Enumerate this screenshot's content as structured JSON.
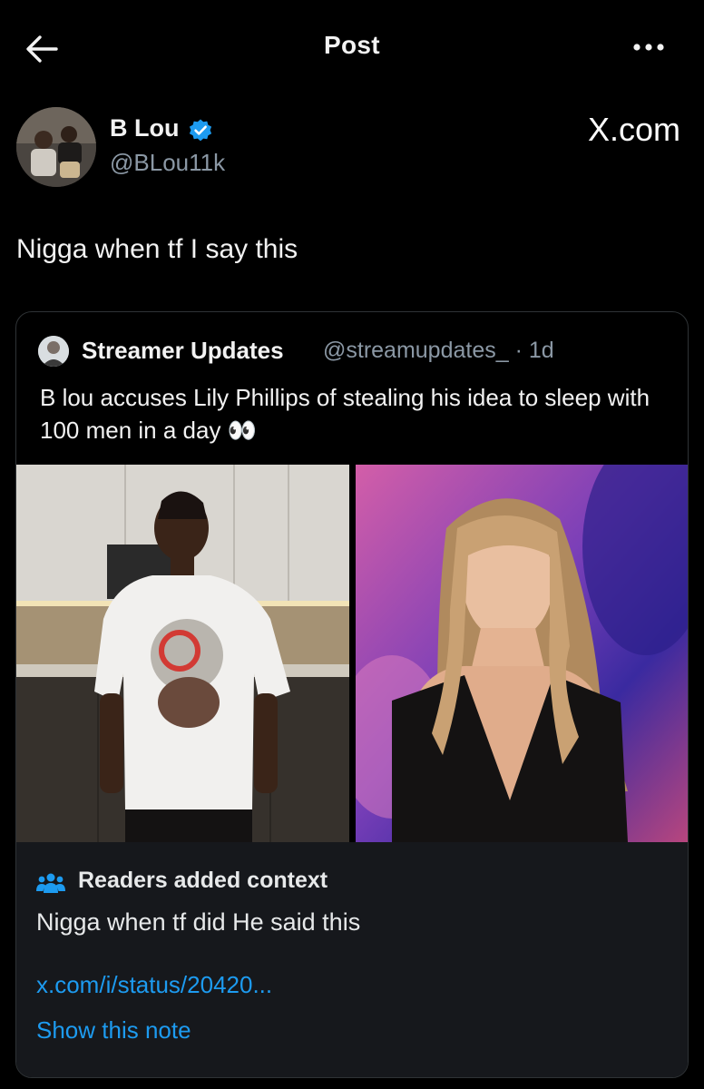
{
  "header": {
    "title": "Post",
    "back_icon": "arrow-left-icon",
    "more_icon": "more-horizontal-icon"
  },
  "author": {
    "name": "B Lou",
    "handle": "@BLou11k",
    "verified": true
  },
  "watermark": "X.com",
  "post": {
    "text": "Nigga when tf I say this"
  },
  "quote": {
    "name": "Streamer Updates",
    "handle": "@streamupdates_",
    "time": "1d",
    "separator": "·",
    "text": "B lou accuses Lily Phillips of stealing his idea to sleep with 100 men in a day 👀"
  },
  "context": {
    "title": "Readers added context",
    "body": "Nigga when tf did He said this",
    "link": "x.com/i/status/20420...",
    "show_note": "Show this note"
  },
  "colors": {
    "background": "#000000",
    "text": "#e7e9ea",
    "secondary": "#8b98a5",
    "link": "#1d9bf0",
    "verified": "#1d9bf0",
    "context_bg": "#16181c"
  }
}
